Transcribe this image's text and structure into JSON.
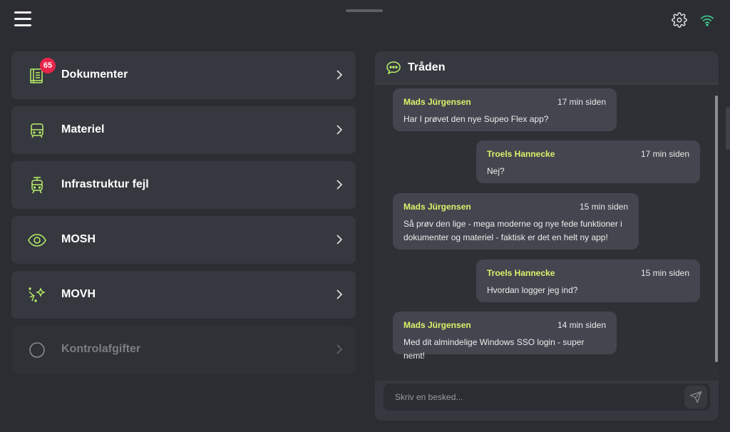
{
  "menu": {
    "items": [
      {
        "label": "Dokumenter",
        "icon": "document-book-icon",
        "badge": "65"
      },
      {
        "label": "Materiel",
        "icon": "train-icon"
      },
      {
        "label": "Infrastruktur fejl",
        "icon": "tram-icon"
      },
      {
        "label": "MOSH",
        "icon": "eye-icon"
      },
      {
        "label": "MOVH",
        "icon": "sparkle-icon"
      },
      {
        "label": "Kontrolafgifter",
        "icon": "circle-icon",
        "disabled": true
      }
    ]
  },
  "thread": {
    "title": "Tråden",
    "messages": [
      {
        "author": "Mads Jürgensen",
        "time": "17 min siden",
        "text": "Har I prøvet den nye Supeo Flex app?",
        "side": "left"
      },
      {
        "author": "Troels Hannecke",
        "time": "17 min siden",
        "text": "Nej?",
        "side": "right"
      },
      {
        "author": "Mads Jürgensen",
        "time": "15 min siden",
        "text": "Så prøv den lige - mega moderne og nye fede funktioner i dokumenter og materiel - faktisk er det en helt ny app!",
        "side": "left"
      },
      {
        "author": "Troels Hannecke",
        "time": "15 min siden",
        "text": "Hvordan logger jeg ind?",
        "side": "right"
      },
      {
        "author": "Mads Jürgensen",
        "time": "14 min siden",
        "text": "Med dit almindelige Windows SSO login - super nemt!",
        "side": "left"
      }
    ],
    "composer_placeholder": "Skriv en besked..."
  },
  "colors": {
    "accent": "#b8f06a",
    "author": "#d8f36a",
    "badge": "#e8244a",
    "wifi": "#3fcf8e"
  }
}
